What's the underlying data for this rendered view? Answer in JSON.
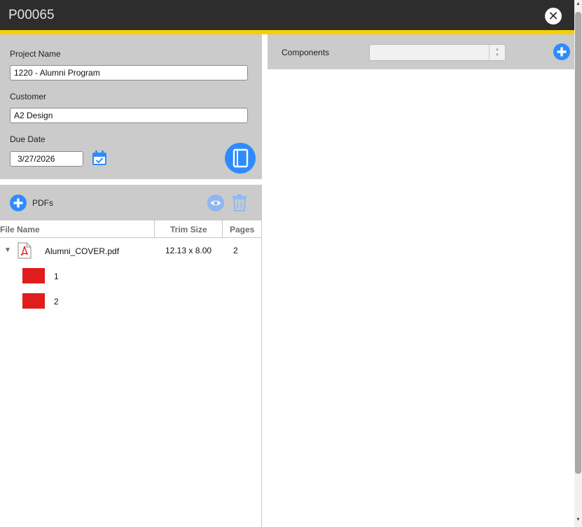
{
  "window": {
    "title": "P00065",
    "close_icon": "close-icon"
  },
  "form": {
    "project_name_label": "Project Name",
    "project_name_value": "1220 - Alumni Program",
    "customer_label": "Customer",
    "customer_value": "A2 Design",
    "due_date_label": "Due Date",
    "due_date_value": "3/27/2026"
  },
  "pdfs": {
    "label": "PDFs",
    "columns": [
      "File Name",
      "Trim Size",
      "Pages"
    ],
    "files": [
      {
        "name": "Alumni_COVER.pdf",
        "trim_size": "12.13 x 8.00",
        "pages": "2",
        "page_thumbs": [
          "1",
          "2"
        ]
      }
    ]
  },
  "components": {
    "label": "Components",
    "selected": ""
  },
  "colors": {
    "accent": "#f7cf00",
    "primary": "#2e8bff",
    "titlebar": "#2d2d2d",
    "panel": "#cbcbcb",
    "thumb": "#e01c1c"
  }
}
